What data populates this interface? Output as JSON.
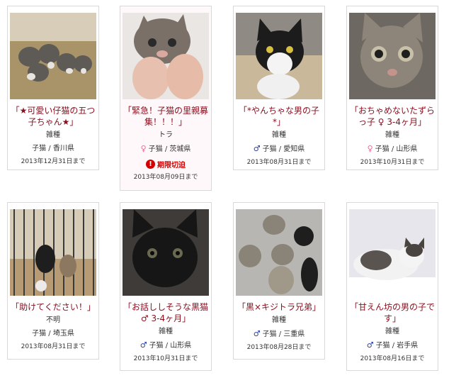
{
  "cards": [
    {
      "title": "「★可愛い仔猫の五つ子ちゃん★」",
      "breed": "雑種",
      "sex": "",
      "sex_color": "",
      "age": "子猫",
      "pref": "香川県",
      "deadline": "2013年12月31日まで",
      "urgent": ""
    },
    {
      "title": "「緊急！子猫の里親募集！！！」",
      "breed": "トラ",
      "sex": "♀",
      "sex_color": "#e06a96",
      "age": "子猫",
      "pref": "茨城県",
      "deadline": "2013年08月09日まで",
      "urgent": "期限切迫"
    },
    {
      "title": "「*やんちゃな男の子*」",
      "breed": "雑種",
      "sex": "♂",
      "sex_color": "#2d3c9a",
      "age": "子猫",
      "pref": "愛知県",
      "deadline": "2013年08月31日まで",
      "urgent": ""
    },
    {
      "title": "「おちゃめないたずらっ子 ♀ 3-4ヶ月」",
      "breed": "雑種",
      "sex": "♀",
      "sex_color": "#e06a96",
      "age": "子猫",
      "pref": "山形県",
      "deadline": "2013年10月31日まで",
      "urgent": ""
    },
    {
      "title": "「助けてください！」",
      "breed": "不明",
      "sex": "",
      "sex_color": "",
      "age": "子猫",
      "pref": "埼玉県",
      "deadline": "2013年08月31日まで",
      "urgent": ""
    },
    {
      "title": "「お話ししそうな黒猫♂ 3-4ヶ月」",
      "breed": "雑種",
      "sex": "♂",
      "sex_color": "#2d3c9a",
      "age": "子猫",
      "pref": "山形県",
      "deadline": "2013年10月31日まで",
      "urgent": ""
    },
    {
      "title": "「黒×キジトラ兄弟」",
      "breed": "雑種",
      "sex": "♂",
      "sex_color": "#2d3c9a",
      "age": "子猫",
      "pref": "三重県",
      "deadline": "2013年08月28日まで",
      "urgent": ""
    },
    {
      "title": "「甘えん坊の男の子です」",
      "breed": "雑種",
      "sex": "♂",
      "sex_color": "#2d3c9a",
      "age": "子猫",
      "pref": "岩手県",
      "deadline": "2013年08月16日まで",
      "urgent": ""
    }
  ],
  "separator": " / "
}
